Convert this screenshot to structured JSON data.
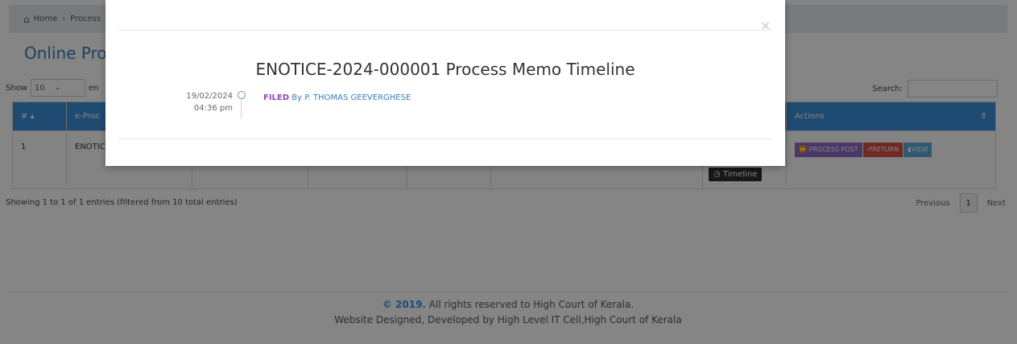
{
  "breadcrumb": {
    "home": "Home",
    "current": "Process"
  },
  "page_title": "Online Proc",
  "table_controls": {
    "show_label": "Show",
    "entries_value": "10",
    "entries_suffix": "en",
    "search_label": "Search:"
  },
  "table": {
    "headers": [
      "#",
      "e-Proc",
      "",
      "",
      "",
      "",
      "",
      "Actions"
    ],
    "row": {
      "num": "1",
      "id": "ENOTIC"
    },
    "actions": {
      "process_post": "PROCESS POST",
      "return": "RETURN",
      "view": "VIEW",
      "timeline": "Timeline"
    }
  },
  "showing_info": "Showing 1 to 1 of 1 entries (filtered from 10 total entries)",
  "pager": {
    "previous": "Previous",
    "current": "1",
    "next": "Next"
  },
  "footer": {
    "copyright_year": "© 2019.",
    "copyright_rest": " All rights reserved to High Court of Kerala.",
    "designed_by": "Website Designed, Developed by High Level IT Cell,High Court of Kerala"
  },
  "modal": {
    "close": "×",
    "title": "ENOTICE-2024-000001 Process Memo Timeline",
    "timeline": [
      {
        "date": "19/02/2024",
        "time": "04:36 pm",
        "status": "FILED",
        "by": "By P. THOMAS GEEVERGHESE"
      }
    ]
  },
  "colors": {
    "accent": "#3d8fd9",
    "process": "#8e6cc4",
    "return": "#d44f4c",
    "view": "#5ba9dd",
    "status_filed": "#8e4ab8"
  }
}
